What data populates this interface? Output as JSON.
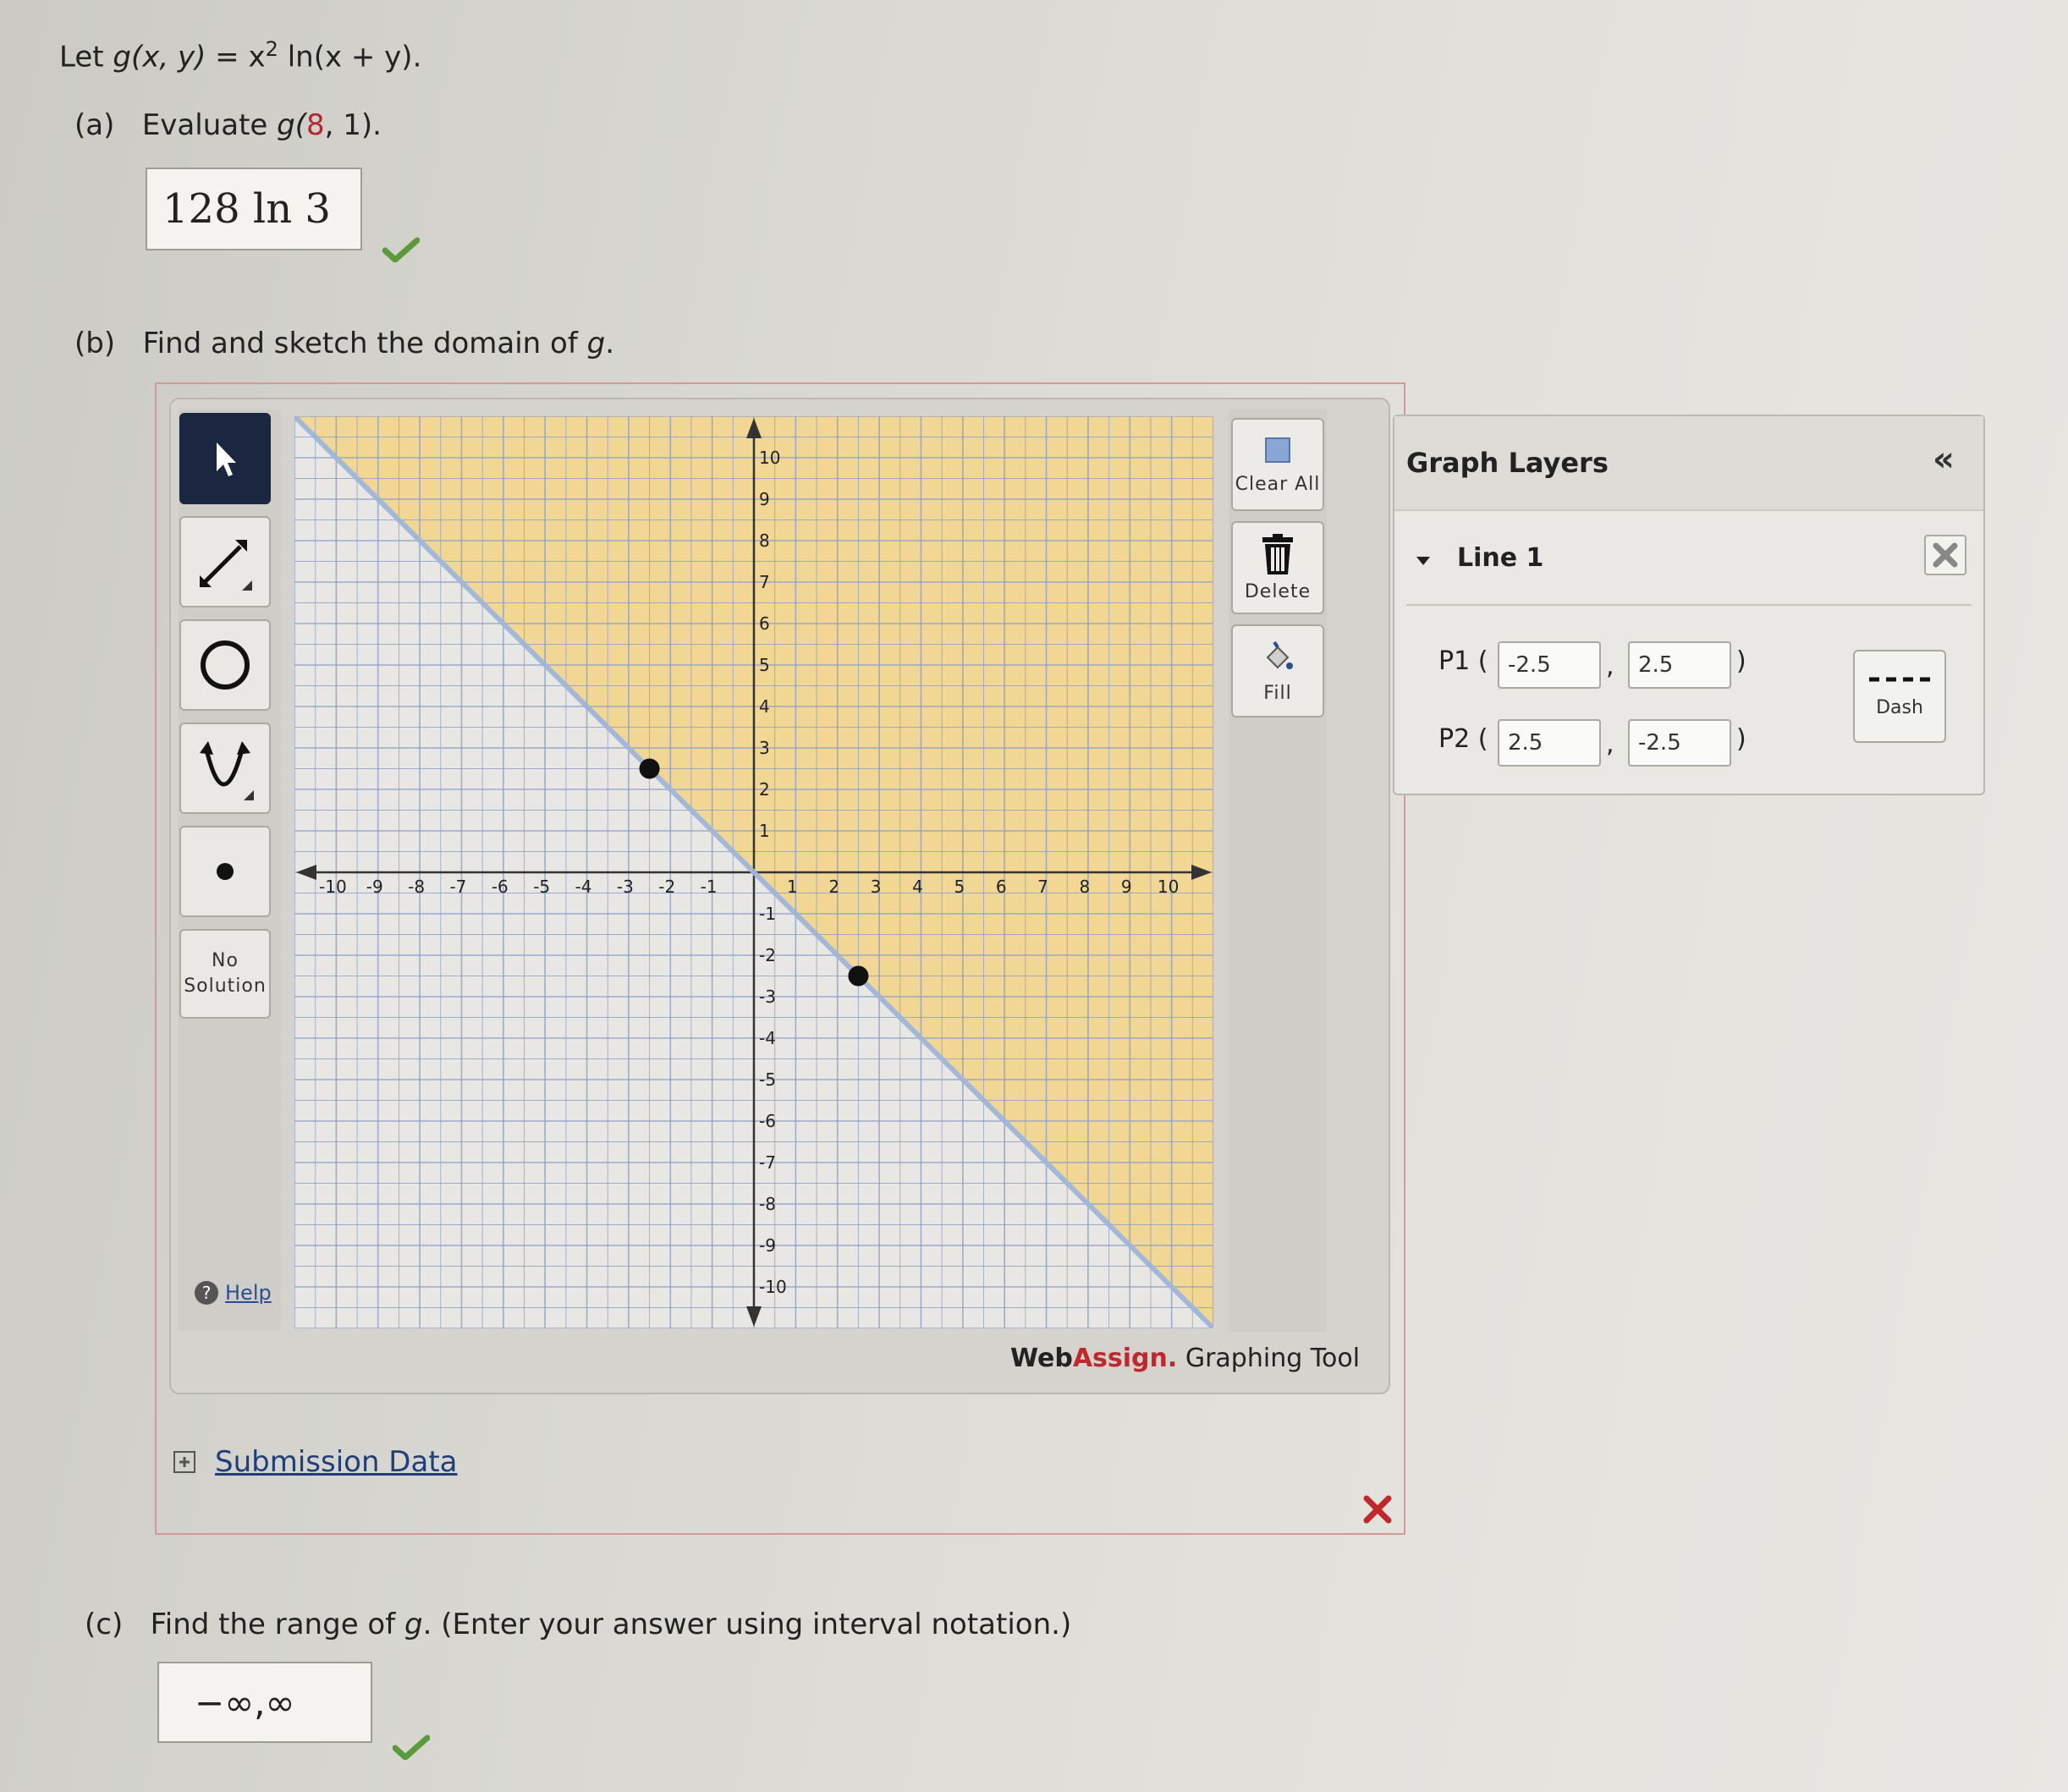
{
  "question": {
    "intro": {
      "prefix": "Let ",
      "lhs": "g(x, y)",
      "eq": " = x",
      "sup": "2",
      "rhs": " ln(x + y)."
    },
    "part_a": {
      "label": "(a)",
      "text_pre": "Evaluate ",
      "func": "g(",
      "arg1": "8",
      "sep": ", 1).",
      "answer": "128 ln  3"
    },
    "part_b": {
      "label": "(b)",
      "text_pre": "Find and sketch the domain of ",
      "var": "g",
      "text_post": "."
    },
    "part_c": {
      "label": "(c)",
      "text_pre": "Find the range of ",
      "var": "g",
      "text_post": ". (Enter your answer using interval notation.)",
      "answer": "−∞,∞"
    }
  },
  "toolbar_left": {
    "no_solution_line1": "No",
    "no_solution_line2": "Solution",
    "help": "Help"
  },
  "toolbar_right": {
    "clear_all": "Clear All",
    "delete": "Delete",
    "fill": "Fill"
  },
  "brand": {
    "web": "Web",
    "assign": "Assign",
    "dot": ".",
    "rest": " Graphing Tool"
  },
  "graph_layers": {
    "title": "Graph Layers",
    "collapse": "«",
    "layer_name": "Line 1",
    "p1_label": "P1 (",
    "p2_label": "P2 (",
    "comma": ",",
    "close_paren": ")",
    "p1_x": "-2.5",
    "p1_y": "2.5",
    "p2_x": "2.5",
    "p2_y": "-2.5",
    "dash_label": "Dash"
  },
  "submission": {
    "label": "Submission Data"
  },
  "colors": {
    "shade": "#f2d58a",
    "line": "#9fb6da",
    "accent_red": "#c0282d",
    "check_green": "#5a9a3a"
  },
  "chart_data": {
    "type": "scatter",
    "xlim": [
      -11,
      11
    ],
    "ylim": [
      -11,
      11
    ],
    "x_ticks": [
      -10,
      -9,
      -8,
      -7,
      -6,
      -5,
      -4,
      -3,
      -2,
      -1,
      1,
      2,
      3,
      4,
      5,
      6,
      7,
      8,
      9,
      10
    ],
    "y_ticks": [
      10,
      9,
      8,
      7,
      6,
      5,
      4,
      3,
      2,
      1,
      -1,
      -2,
      -3,
      -4,
      -5,
      -6,
      -7,
      -8,
      -9,
      -10
    ],
    "line": {
      "slope": -1,
      "intercept": 0,
      "style": "dashed"
    },
    "points": [
      {
        "x": -2.5,
        "y": 2.5
      },
      {
        "x": 2.5,
        "y": -2.5
      }
    ],
    "shaded_region": "x + y > 0",
    "grid": true
  }
}
